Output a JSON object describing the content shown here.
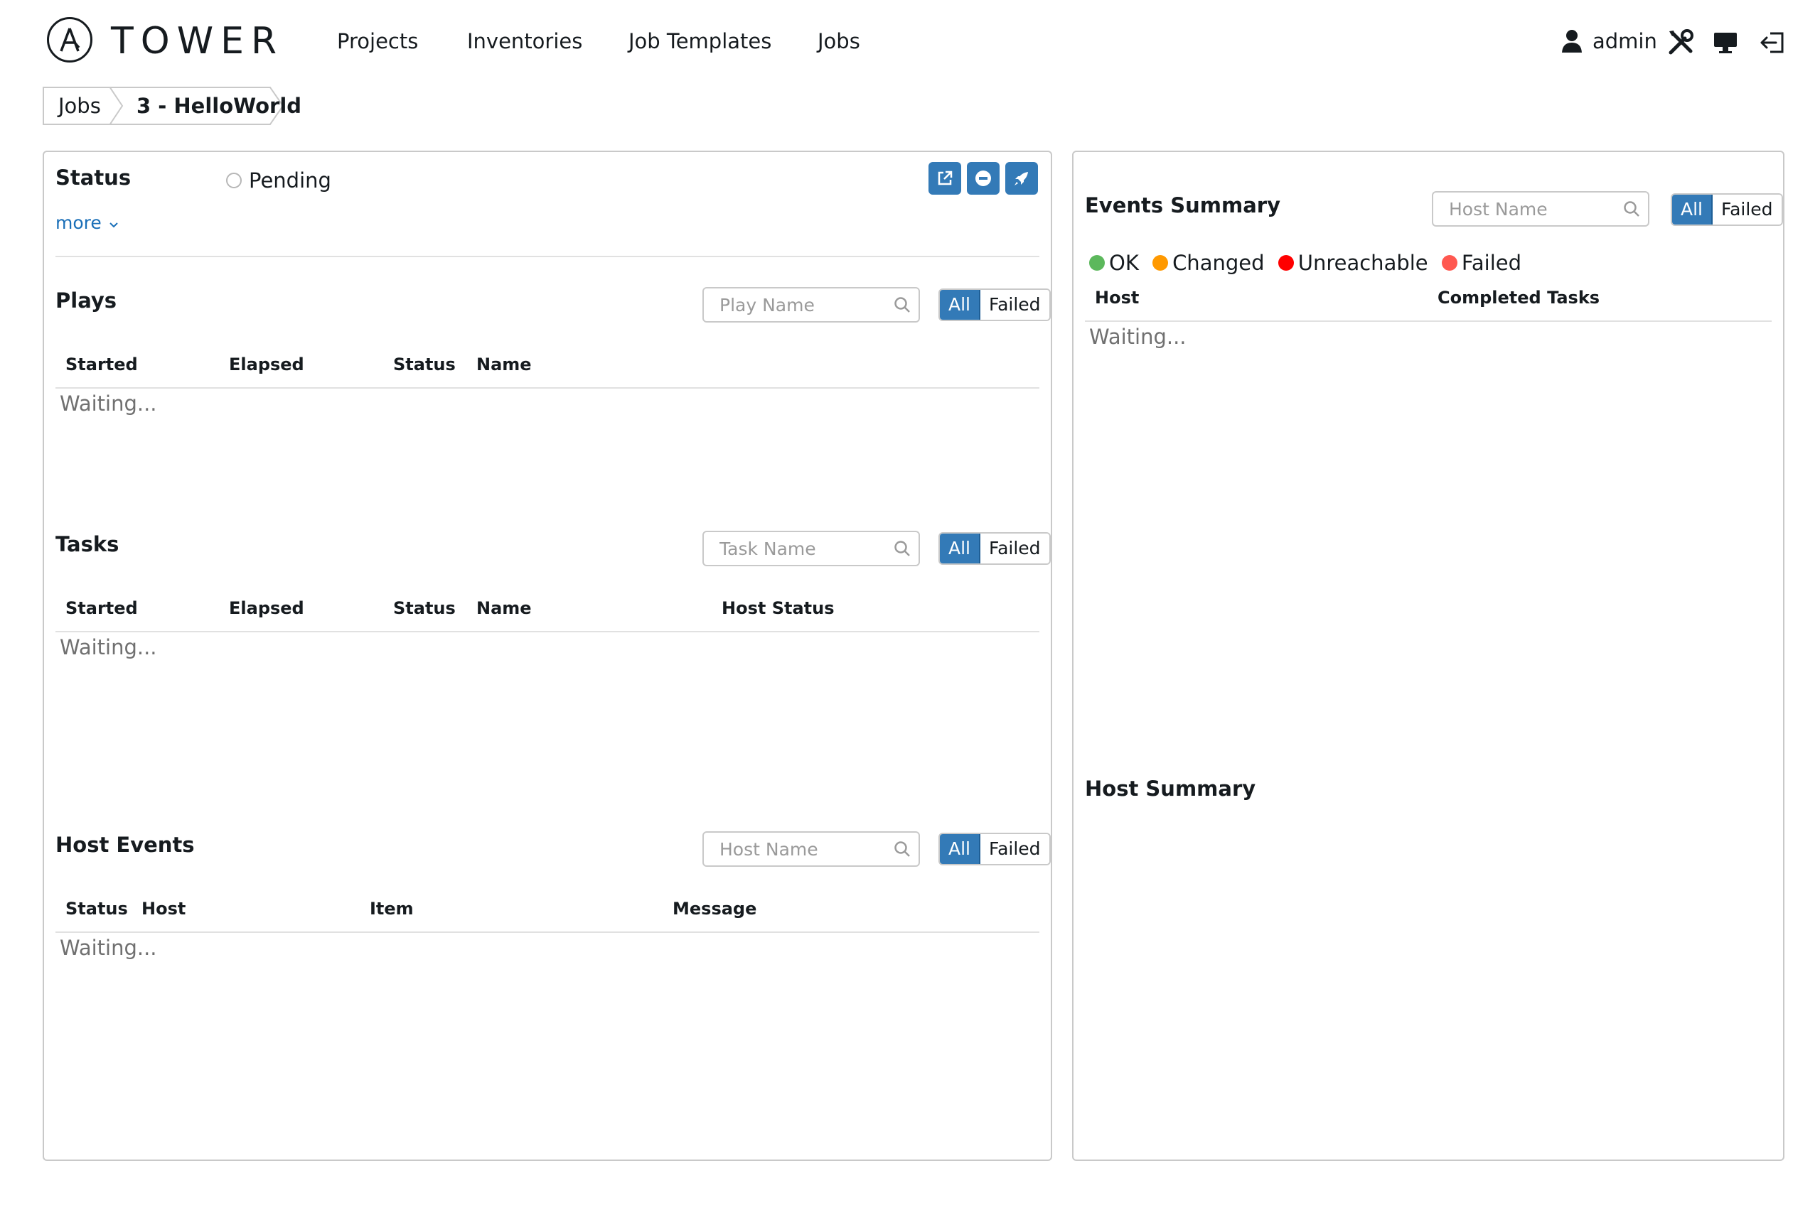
{
  "brand": {
    "name": "TOWER"
  },
  "nav": {
    "projects": "Projects",
    "inventories": "Inventories",
    "job_templates": "Job Templates",
    "jobs": "Jobs",
    "user": "admin"
  },
  "breadcrumb": {
    "parent": "Jobs",
    "current": "3 - HelloWorld"
  },
  "status": {
    "title": "Status",
    "value": "Pending",
    "more": "more"
  },
  "plays": {
    "title": "Plays",
    "search_placeholder": "Play Name",
    "filter_all": "All",
    "filter_failed": "Failed",
    "columns": [
      "Started",
      "Elapsed",
      "Status",
      "Name"
    ],
    "waiting": "Waiting..."
  },
  "tasks": {
    "title": "Tasks",
    "search_placeholder": "Task Name",
    "filter_all": "All",
    "filter_failed": "Failed",
    "columns": [
      "Started",
      "Elapsed",
      "Status",
      "Name",
      "Host Status"
    ],
    "waiting": "Waiting..."
  },
  "host_events": {
    "title": "Host Events",
    "search_placeholder": "Host Name",
    "filter_all": "All",
    "filter_failed": "Failed",
    "columns": [
      "Status",
      "Host",
      "Item",
      "Message"
    ],
    "waiting": "Waiting..."
  },
  "events_summary": {
    "title": "Events Summary",
    "search_placeholder": "Host Name",
    "filter_all": "All",
    "filter_failed": "Failed",
    "legend": [
      {
        "label": "OK",
        "color": "#5cb85c"
      },
      {
        "label": "Changed",
        "color": "#ff9900"
      },
      {
        "label": "Unreachable",
        "color": "#ff0000"
      },
      {
        "label": "Failed",
        "color": "#ff5850"
      }
    ],
    "columns": [
      "Host",
      "Completed Tasks"
    ],
    "waiting": "Waiting..."
  },
  "host_summary": {
    "title": "Host Summary"
  },
  "colors": {
    "accent": "#337ab7",
    "link": "#1a6fb8",
    "border": "#c9c9c9"
  }
}
